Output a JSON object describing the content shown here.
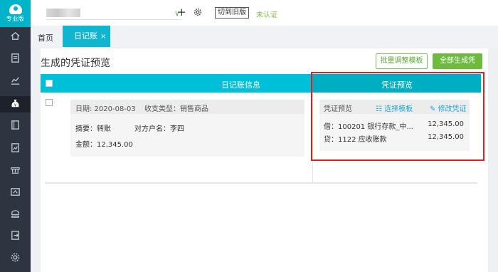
{
  "sidebar": {
    "logo_text": "专业版",
    "items": [
      {
        "icon": "home-icon"
      },
      {
        "icon": "document-icon"
      },
      {
        "icon": "chart-icon"
      },
      {
        "icon": "money-bag-icon"
      },
      {
        "icon": "book-icon"
      },
      {
        "icon": "report-icon"
      },
      {
        "icon": "bank-icon"
      },
      {
        "icon": "invoice-icon"
      },
      {
        "icon": "stamp-icon"
      },
      {
        "icon": "export-icon"
      },
      {
        "icon": "settings-icon"
      }
    ]
  },
  "topbar": {
    "switch_old_label": "切到旧版",
    "verify_status": "未认证"
  },
  "tabs": {
    "home": "首页",
    "active": "日记账",
    "close": "×"
  },
  "page": {
    "title": "生成的凭证预览",
    "batch_button": "批量调整模板",
    "generate_all_button": "全部生成凭"
  },
  "table": {
    "left_header": "日记账信息",
    "right_header": "凭证预览"
  },
  "record": {
    "date": "日期: 2020-08-03",
    "type": "收支类型：销售商品",
    "summary": "摘要：转账",
    "party": "对方户名：李四",
    "amount": "金额：12,345.00"
  },
  "voucher": {
    "label": "凭证预览",
    "choose_template": "选择模板",
    "edit_voucher": "修改凭证",
    "debit_line": "借：100201 银行存款_中...",
    "debit_amount": "12,345.00",
    "credit_line": "贷：1122 应收账款",
    "credit_amount": "12,345.00"
  },
  "colors": {
    "accent": "#00bfd8",
    "accent_dark": "#00aec4",
    "green": "#6cbb3e",
    "link": "#1da7d6",
    "sidebar": "#2f3441",
    "highlight": "#e02020"
  }
}
